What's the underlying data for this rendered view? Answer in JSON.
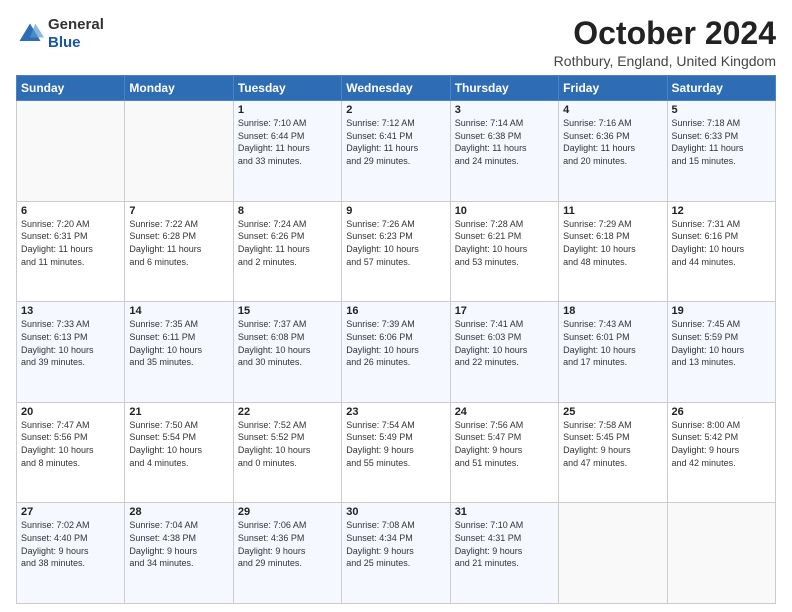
{
  "header": {
    "logo": {
      "general": "General",
      "blue": "Blue"
    },
    "title": "October 2024",
    "location": "Rothbury, England, United Kingdom"
  },
  "days_of_week": [
    "Sunday",
    "Monday",
    "Tuesday",
    "Wednesday",
    "Thursday",
    "Friday",
    "Saturday"
  ],
  "weeks": [
    [
      {
        "day": "",
        "info": ""
      },
      {
        "day": "",
        "info": ""
      },
      {
        "day": "1",
        "info": "Sunrise: 7:10 AM\nSunset: 6:44 PM\nDaylight: 11 hours\nand 33 minutes."
      },
      {
        "day": "2",
        "info": "Sunrise: 7:12 AM\nSunset: 6:41 PM\nDaylight: 11 hours\nand 29 minutes."
      },
      {
        "day": "3",
        "info": "Sunrise: 7:14 AM\nSunset: 6:38 PM\nDaylight: 11 hours\nand 24 minutes."
      },
      {
        "day": "4",
        "info": "Sunrise: 7:16 AM\nSunset: 6:36 PM\nDaylight: 11 hours\nand 20 minutes."
      },
      {
        "day": "5",
        "info": "Sunrise: 7:18 AM\nSunset: 6:33 PM\nDaylight: 11 hours\nand 15 minutes."
      }
    ],
    [
      {
        "day": "6",
        "info": "Sunrise: 7:20 AM\nSunset: 6:31 PM\nDaylight: 11 hours\nand 11 minutes."
      },
      {
        "day": "7",
        "info": "Sunrise: 7:22 AM\nSunset: 6:28 PM\nDaylight: 11 hours\nand 6 minutes."
      },
      {
        "day": "8",
        "info": "Sunrise: 7:24 AM\nSunset: 6:26 PM\nDaylight: 11 hours\nand 2 minutes."
      },
      {
        "day": "9",
        "info": "Sunrise: 7:26 AM\nSunset: 6:23 PM\nDaylight: 10 hours\nand 57 minutes."
      },
      {
        "day": "10",
        "info": "Sunrise: 7:28 AM\nSunset: 6:21 PM\nDaylight: 10 hours\nand 53 minutes."
      },
      {
        "day": "11",
        "info": "Sunrise: 7:29 AM\nSunset: 6:18 PM\nDaylight: 10 hours\nand 48 minutes."
      },
      {
        "day": "12",
        "info": "Sunrise: 7:31 AM\nSunset: 6:16 PM\nDaylight: 10 hours\nand 44 minutes."
      }
    ],
    [
      {
        "day": "13",
        "info": "Sunrise: 7:33 AM\nSunset: 6:13 PM\nDaylight: 10 hours\nand 39 minutes."
      },
      {
        "day": "14",
        "info": "Sunrise: 7:35 AM\nSunset: 6:11 PM\nDaylight: 10 hours\nand 35 minutes."
      },
      {
        "day": "15",
        "info": "Sunrise: 7:37 AM\nSunset: 6:08 PM\nDaylight: 10 hours\nand 30 minutes."
      },
      {
        "day": "16",
        "info": "Sunrise: 7:39 AM\nSunset: 6:06 PM\nDaylight: 10 hours\nand 26 minutes."
      },
      {
        "day": "17",
        "info": "Sunrise: 7:41 AM\nSunset: 6:03 PM\nDaylight: 10 hours\nand 22 minutes."
      },
      {
        "day": "18",
        "info": "Sunrise: 7:43 AM\nSunset: 6:01 PM\nDaylight: 10 hours\nand 17 minutes."
      },
      {
        "day": "19",
        "info": "Sunrise: 7:45 AM\nSunset: 5:59 PM\nDaylight: 10 hours\nand 13 minutes."
      }
    ],
    [
      {
        "day": "20",
        "info": "Sunrise: 7:47 AM\nSunset: 5:56 PM\nDaylight: 10 hours\nand 8 minutes."
      },
      {
        "day": "21",
        "info": "Sunrise: 7:50 AM\nSunset: 5:54 PM\nDaylight: 10 hours\nand 4 minutes."
      },
      {
        "day": "22",
        "info": "Sunrise: 7:52 AM\nSunset: 5:52 PM\nDaylight: 10 hours\nand 0 minutes."
      },
      {
        "day": "23",
        "info": "Sunrise: 7:54 AM\nSunset: 5:49 PM\nDaylight: 9 hours\nand 55 minutes."
      },
      {
        "day": "24",
        "info": "Sunrise: 7:56 AM\nSunset: 5:47 PM\nDaylight: 9 hours\nand 51 minutes."
      },
      {
        "day": "25",
        "info": "Sunrise: 7:58 AM\nSunset: 5:45 PM\nDaylight: 9 hours\nand 47 minutes."
      },
      {
        "day": "26",
        "info": "Sunrise: 8:00 AM\nSunset: 5:42 PM\nDaylight: 9 hours\nand 42 minutes."
      }
    ],
    [
      {
        "day": "27",
        "info": "Sunrise: 7:02 AM\nSunset: 4:40 PM\nDaylight: 9 hours\nand 38 minutes."
      },
      {
        "day": "28",
        "info": "Sunrise: 7:04 AM\nSunset: 4:38 PM\nDaylight: 9 hours\nand 34 minutes."
      },
      {
        "day": "29",
        "info": "Sunrise: 7:06 AM\nSunset: 4:36 PM\nDaylight: 9 hours\nand 29 minutes."
      },
      {
        "day": "30",
        "info": "Sunrise: 7:08 AM\nSunset: 4:34 PM\nDaylight: 9 hours\nand 25 minutes."
      },
      {
        "day": "31",
        "info": "Sunrise: 7:10 AM\nSunset: 4:31 PM\nDaylight: 9 hours\nand 21 minutes."
      },
      {
        "day": "",
        "info": ""
      },
      {
        "day": "",
        "info": ""
      }
    ]
  ]
}
